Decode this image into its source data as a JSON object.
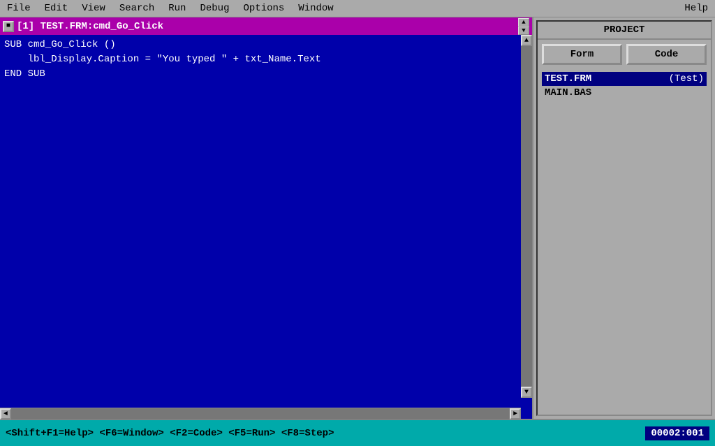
{
  "menubar": {
    "items": [
      {
        "label": "File",
        "id": "file"
      },
      {
        "label": "Edit",
        "id": "edit"
      },
      {
        "label": "View",
        "id": "view"
      },
      {
        "label": "Search",
        "id": "search"
      },
      {
        "label": "Run",
        "id": "run"
      },
      {
        "label": "Debug",
        "id": "debug"
      },
      {
        "label": "Options",
        "id": "options"
      },
      {
        "label": "Window",
        "id": "window"
      },
      {
        "label": "Help",
        "id": "help"
      }
    ]
  },
  "editor": {
    "titlebar": "[1] TEST.FRM:cmd_Go_Click",
    "code_lines": [
      "SUB cmd_Go_Click ()",
      "    lbl_Display.Caption = \"You typed \" + txt_Name.Text",
      "END SUB"
    ]
  },
  "project": {
    "title": "PROJECT",
    "form_button": "Form",
    "code_button": "Code",
    "files": [
      {
        "name": "TEST.FRM",
        "extra": "(Test)",
        "selected": true
      },
      {
        "name": "MAIN.BAS",
        "extra": "",
        "selected": false
      }
    ]
  },
  "statusbar": {
    "shortcuts": "<Shift+F1=Help>  <F6=Window>  <F2=Code>  <F5=Run>  <F8=Step>",
    "position": "00002:001"
  },
  "scrollbar": {
    "up_arrow": "▲",
    "down_arrow": "▼",
    "left_arrow": "◄",
    "right_arrow": "►"
  }
}
